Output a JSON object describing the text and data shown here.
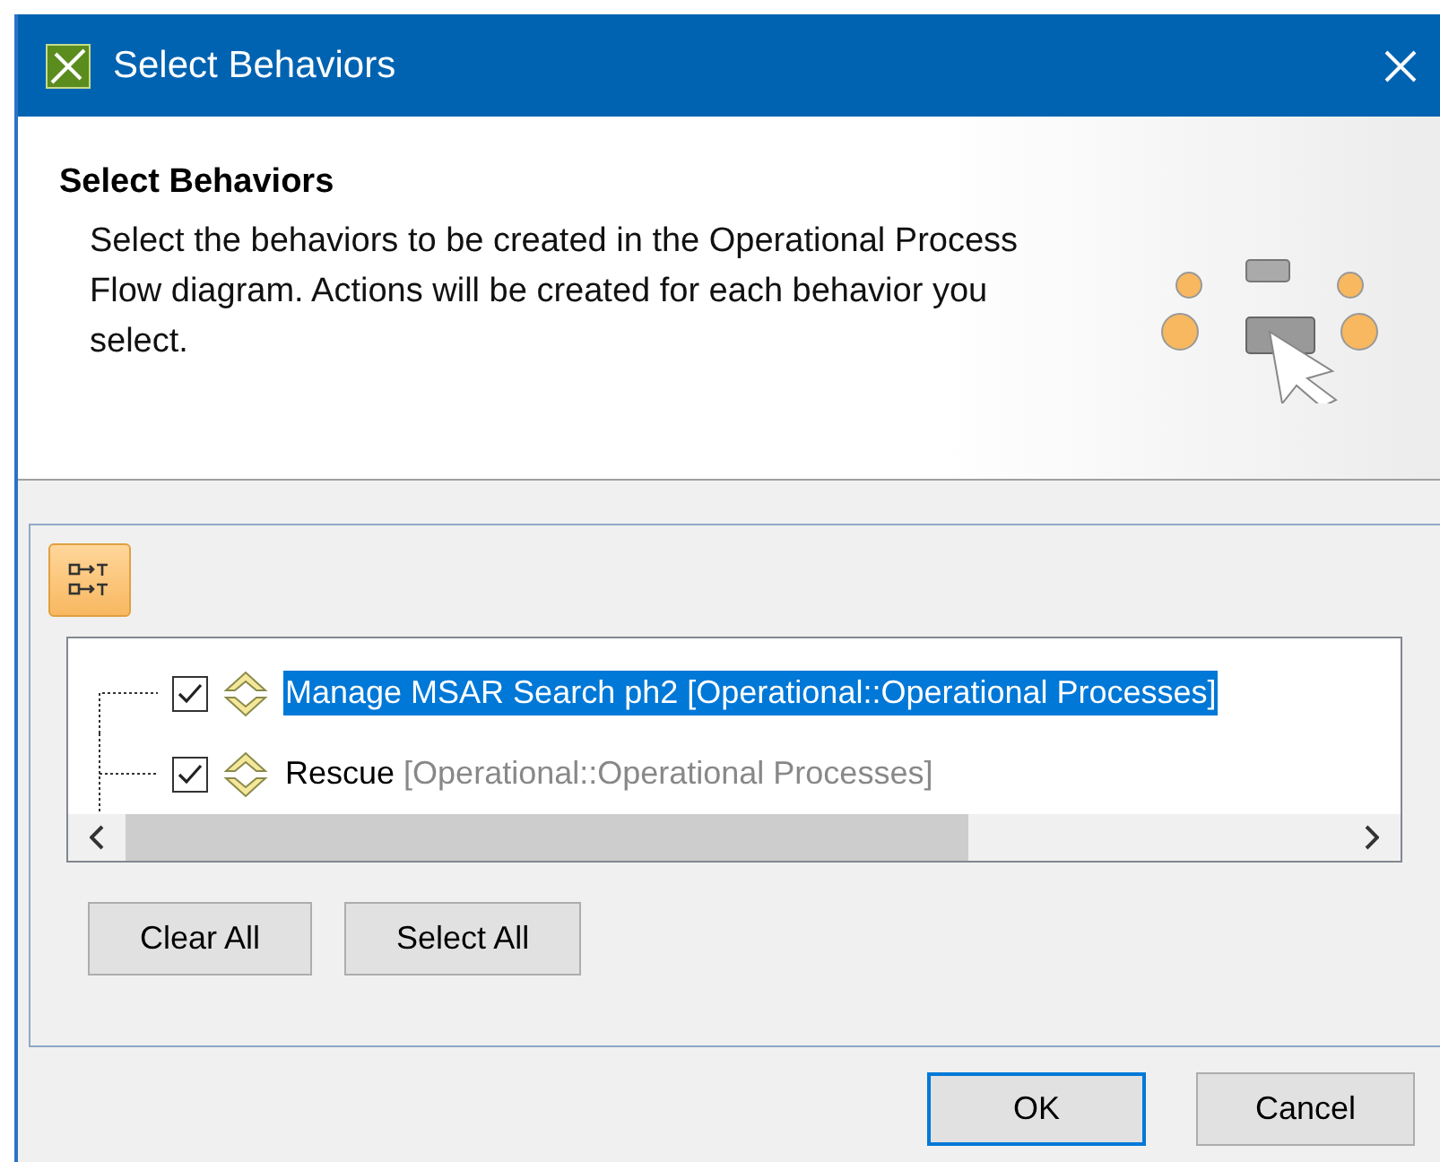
{
  "window": {
    "title": "Select Behaviors"
  },
  "header": {
    "title": "Select Behaviors",
    "description": "Select the behaviors to be created in the Operational Process Flow diagram. Actions will be created for each behavior you select."
  },
  "tree": {
    "rows": [
      {
        "name": "Manage MSAR Search ph2",
        "qualifier": "[Operational::Operational Processes]",
        "checked": true,
        "selected": true
      },
      {
        "name": "Rescue",
        "qualifier": "[Operational::Operational Processes]",
        "checked": true,
        "selected": false
      }
    ]
  },
  "panel_buttons": [
    "Clear All",
    "Select All"
  ],
  "dialog_buttons": [
    {
      "label": "OK",
      "default": true
    },
    {
      "label": "Cancel",
      "default": false
    }
  ]
}
